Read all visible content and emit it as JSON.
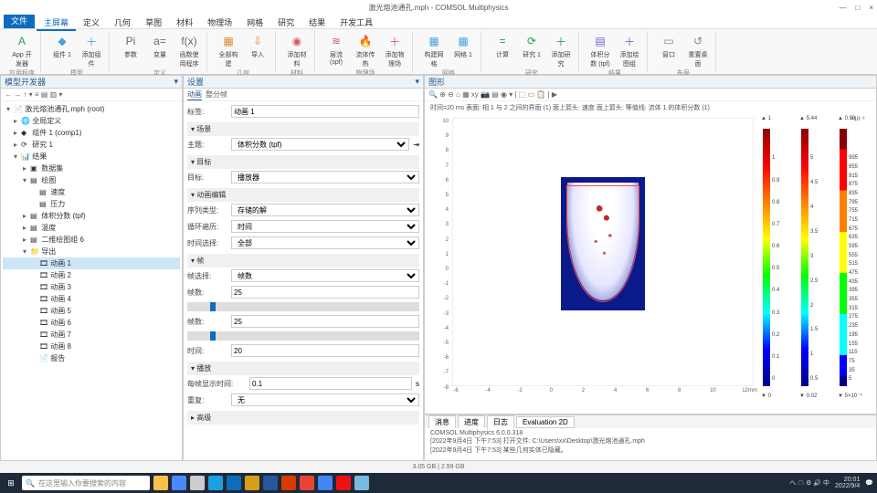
{
  "window": {
    "title": "激光熔池通孔.mph - COMSOL Multiphysics",
    "min": "—",
    "max": "□",
    "close": "×"
  },
  "menu": {
    "file": "文件",
    "tabs": [
      "主屏幕",
      "定义",
      "几何",
      "草图",
      "材料",
      "物理场",
      "网格",
      "研究",
      "结果",
      "开发工具"
    ],
    "active": 0
  },
  "ribbon": {
    "groups": [
      {
        "label": "应用程序",
        "items": [
          {
            "name": "app-builder",
            "glyph": "A",
            "color": "#2e9e4f",
            "label": "App 开发器"
          }
        ]
      },
      {
        "label": "模型",
        "items": [
          {
            "name": "component",
            "glyph": "◆",
            "color": "#4aa3df",
            "label": "组件 1"
          },
          {
            "name": "add-component",
            "glyph": "＋",
            "color": "#4aa3df",
            "label": "添加组件"
          }
        ]
      },
      {
        "label": "定义",
        "items": [
          {
            "name": "parameters",
            "glyph": "Pi",
            "color": "#6a6a6a",
            "label": "参数"
          },
          {
            "name": "variables",
            "glyph": "a=",
            "color": "#6a6a6a",
            "label": "变量"
          },
          {
            "name": "functions",
            "glyph": "f(x)",
            "color": "#6a6a6a",
            "label": "函数使用程序"
          }
        ]
      },
      {
        "label": "几何",
        "items": [
          {
            "name": "build-all",
            "glyph": "▦",
            "color": "#e08a2e",
            "label": "全部构建"
          },
          {
            "name": "import",
            "glyph": "⇩",
            "color": "#e08a2e",
            "label": "导入"
          }
        ]
      },
      {
        "label": "材料",
        "items": [
          {
            "name": "add-material",
            "glyph": "◉",
            "color": "#d65a5a",
            "label": "添加材料"
          }
        ]
      },
      {
        "label": "物理场",
        "items": [
          {
            "name": "laminar-flow",
            "glyph": "≋",
            "color": "#d65a5a",
            "label": "层流 (spf)"
          },
          {
            "name": "heat-transfer",
            "glyph": "🔥",
            "color": "#d65a5a",
            "label": "流体传热"
          },
          {
            "name": "add-physics",
            "glyph": "＋",
            "color": "#d65a5a",
            "label": "添加物理场"
          }
        ]
      },
      {
        "label": "网格",
        "items": [
          {
            "name": "build-mesh",
            "glyph": "▦",
            "color": "#4aa3df",
            "label": "构建网格"
          },
          {
            "name": "mesh1",
            "glyph": "▦",
            "color": "#4aa3df",
            "label": "网格 1"
          }
        ]
      },
      {
        "label": "研究",
        "items": [
          {
            "name": "compute",
            "glyph": "=",
            "color": "#2e9e4f",
            "label": "计算"
          },
          {
            "name": "study1",
            "glyph": "⟳",
            "color": "#2e9e4f",
            "label": "研究 1"
          },
          {
            "name": "add-study",
            "glyph": "＋",
            "color": "#2e9e4f",
            "label": "添加研究"
          }
        ]
      },
      {
        "label": "结果",
        "items": [
          {
            "name": "vf-tpf",
            "glyph": "▤",
            "color": "#7a5ad6",
            "label": "体积分数 (tpf)"
          },
          {
            "name": "add-plot",
            "glyph": "＋",
            "color": "#7a5ad6",
            "label": "添加绘图组"
          }
        ]
      },
      {
        "label": "布局",
        "items": [
          {
            "name": "windows",
            "glyph": "▭",
            "color": "#888",
            "label": "窗口"
          },
          {
            "name": "reset-desktop",
            "glyph": "↺",
            "color": "#888",
            "label": "重置桌面"
          }
        ]
      }
    ]
  },
  "model_tree": {
    "title": "模型开发器",
    "nodes": [
      {
        "d": 0,
        "exp": "▾",
        "ico": "📄",
        "label": "激光熔池通孔.mph (root)"
      },
      {
        "d": 1,
        "exp": "▸",
        "ico": "🌐",
        "label": "全局定义"
      },
      {
        "d": 1,
        "exp": "▸",
        "ico": "◆",
        "label": "组件 1 (comp1)"
      },
      {
        "d": 1,
        "exp": "▸",
        "ico": "⟳",
        "label": "研究 1"
      },
      {
        "d": 1,
        "exp": "▾",
        "ico": "📊",
        "label": "结果"
      },
      {
        "d": 2,
        "exp": "▸",
        "ico": "▣",
        "label": "数据集"
      },
      {
        "d": 2,
        "exp": "▾",
        "ico": "▤",
        "label": "绘图"
      },
      {
        "d": 3,
        "exp": " ",
        "ico": "▤",
        "label": "速度"
      },
      {
        "d": 3,
        "exp": " ",
        "ico": "▤",
        "label": "压力"
      },
      {
        "d": 2,
        "exp": "▸",
        "ico": "▤",
        "label": "体积分数 (tpf)"
      },
      {
        "d": 2,
        "exp": "▸",
        "ico": "▤",
        "label": "温度"
      },
      {
        "d": 2,
        "exp": "▸",
        "ico": "▤",
        "label": "二维绘图组 6"
      },
      {
        "d": 2,
        "exp": "▾",
        "ico": "📁",
        "label": "导出"
      },
      {
        "d": 3,
        "exp": " ",
        "ico": "🎞",
        "label": "动画 1",
        "sel": true
      },
      {
        "d": 3,
        "exp": " ",
        "ico": "🎞",
        "label": "动画 2"
      },
      {
        "d": 3,
        "exp": " ",
        "ico": "🎞",
        "label": "动画 3"
      },
      {
        "d": 3,
        "exp": " ",
        "ico": "🎞",
        "label": "动画 4"
      },
      {
        "d": 3,
        "exp": " ",
        "ico": "🎞",
        "label": "动画 5"
      },
      {
        "d": 3,
        "exp": " ",
        "ico": "🎞",
        "label": "动画 6"
      },
      {
        "d": 3,
        "exp": " ",
        "ico": "🎞",
        "label": "动画 7"
      },
      {
        "d": 3,
        "exp": " ",
        "ico": "🎞",
        "label": "动画 8"
      },
      {
        "d": 3,
        "exp": " ",
        "ico": "📄",
        "label": "报告"
      }
    ]
  },
  "settings": {
    "title": "设置",
    "tabs": [
      "动画",
      "整分帧"
    ],
    "label_field": {
      "label": "标签:",
      "value": "动画 1"
    },
    "scene": {
      "head": "▾ 场景",
      "subject_label": "主题:",
      "subject_value": "体积分数 (tpf)"
    },
    "target": {
      "head": "▾ 目标",
      "target_label": "目标:",
      "target_value": "播放器"
    },
    "anim_edit": {
      "head": "▾ 动画编辑",
      "seq_type_label": "序列类型:",
      "seq_type_value": "存储的解",
      "loop_label": "循环遍历:",
      "loop_value": "时间",
      "time_sel_label": "时间选择:",
      "time_sel_value": "全部"
    },
    "frames": {
      "head": "▾ 帧",
      "fps_sel_label": "帧选择:",
      "fps_sel_value": "帧数",
      "frames_label": "帧数:",
      "frames_value": "25",
      "frames2_label": "帧数:",
      "frames2_value": "25",
      "time_label": "时间:",
      "time_value": "20"
    },
    "play": {
      "head": "▾ 播放",
      "delay_label": "每帧显示时间:",
      "delay_value": "0.1",
      "repeat_label": "重复:",
      "repeat_value": "无"
    },
    "advanced": {
      "head": "▸ 高级"
    }
  },
  "graphics": {
    "title": "图形",
    "info": "时间=20 ms    表面: 相 1 与 2 之间的界面 (1)  面上箭头: 速度  面上箭头:    等值线: 流体 1 的体积分数 (1)",
    "y_ticks": [
      "10",
      "9",
      "8",
      "7",
      "6",
      "5",
      "4",
      "3",
      "2",
      "1",
      "0",
      "-1",
      "-2",
      "-3",
      "-4",
      "-5",
      "-6",
      "-7",
      "-8"
    ],
    "x_ticks": [
      "-6",
      "-4",
      "-2",
      "0",
      "2",
      "4",
      "6",
      "8",
      "10",
      "12"
    ],
    "x_unit": "mm",
    "cbars": [
      {
        "top": "▲ 1",
        "bot": "▼ 0",
        "ticks": [
          "1",
          "0.9",
          "0.8",
          "0.7",
          "0.6",
          "0.5",
          "0.4",
          "0.3",
          "0.2",
          "0.1",
          "0"
        ]
      },
      {
        "top": "▲ 5.44",
        "bot": "▼ 0.02",
        "ticks": [
          "5",
          "4.5",
          "4",
          "3.5",
          "3",
          "2.5",
          "2",
          "1.5",
          "1",
          "0.5"
        ]
      },
      {
        "top": "▲ 0.99",
        "unit": "×10⁻³",
        "bot": "▼ 5×10⁻⁴",
        "ticks": [
          "995",
          "955",
          "915",
          "875",
          "835",
          "795",
          "755",
          "715",
          "675",
          "635",
          "595",
          "555",
          "515",
          "475",
          "435",
          "395",
          "355",
          "315",
          "275",
          "235",
          "195",
          "155",
          "115",
          "75",
          "35",
          "5"
        ]
      }
    ]
  },
  "log": {
    "tabs": [
      "消息",
      "进度",
      "日志",
      "Evaluation 2D"
    ],
    "lines": [
      "COMSOL Multiphysics 6.0.0.318",
      "[2022年9月4日 下午7:53] 打开文件: C:\\Users\\xx\\Desktop\\激光熔池通孔.mph",
      "[2022年9月4日 下午7:53] 某些几何实体已隐藏。"
    ]
  },
  "status": {
    "mem": "3.05 GB | 2.99 GB"
  },
  "taskbar": {
    "search_placeholder": "在这里输入你要搜索的内容",
    "time": "20:01",
    "date": "2022/9/4",
    "tray": "へ ☁ ⚙ 🔊 中"
  },
  "chart_data": {
    "type": "heatmap",
    "title": "时间=20 ms 体积分数 / 速度 / 等值线",
    "xlabel": "mm",
    "ylabel": "",
    "xlim": [
      -6,
      12
    ],
    "ylim": [
      -8,
      10
    ],
    "series": [
      {
        "name": "相界面体积分数",
        "range": [
          0,
          1
        ]
      },
      {
        "name": "速度",
        "range": [
          0.02,
          5.44
        ]
      },
      {
        "name": "流体1体积分数×10⁻³",
        "range": [
          5,
          995
        ]
      }
    ],
    "note": "2D simulation field — cavity region roughly x∈[-1,3], y∈[-2,6]; values read from colorbars"
  }
}
